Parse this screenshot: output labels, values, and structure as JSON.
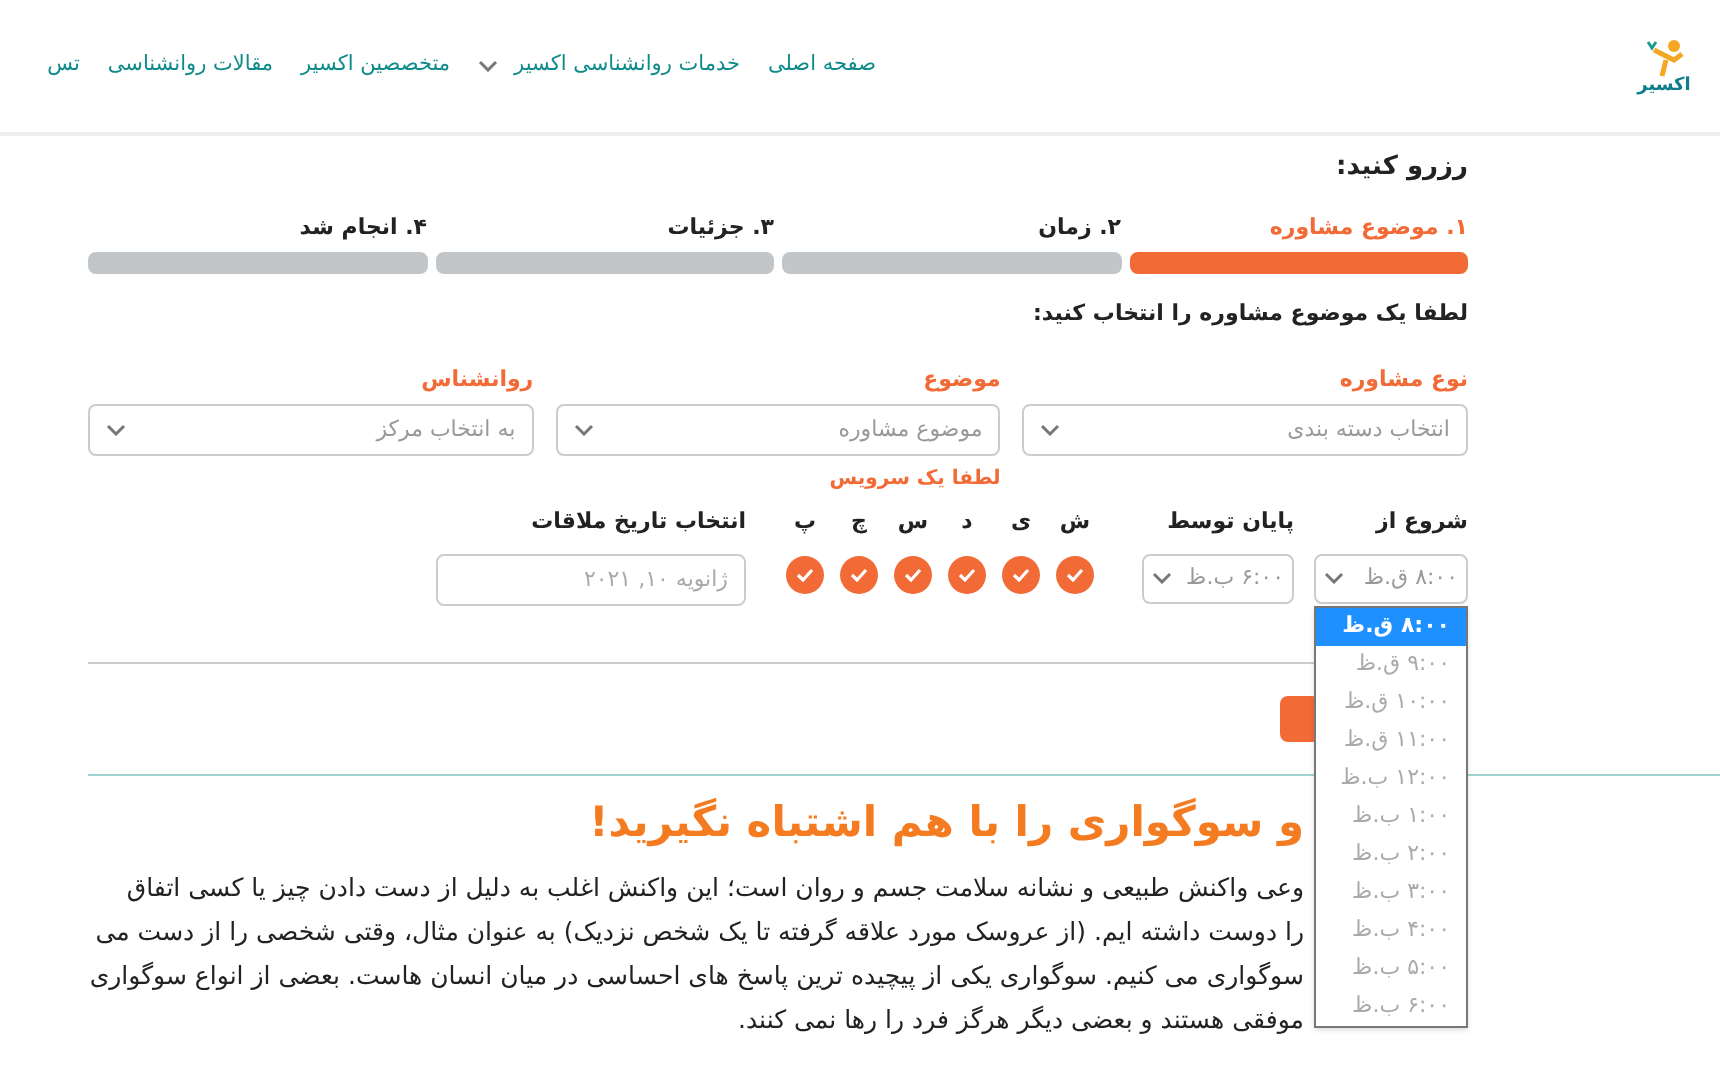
{
  "nav": {
    "logo_text": "اکسیر",
    "items": [
      {
        "label": "صفحه اصلی",
        "has_menu": false
      },
      {
        "label": "خدمات روانشناسی اکسیر",
        "has_menu": true
      },
      {
        "label": "متخصصین اکسیر",
        "has_menu": false
      },
      {
        "label": "مقالات روانشناسی",
        "has_menu": false
      },
      {
        "label": "تس",
        "has_menu": false
      }
    ]
  },
  "booking": {
    "title": "رزرو کنید:",
    "steps": [
      {
        "label": "۱. موضوع مشاوره",
        "selected": true
      },
      {
        "label": "۲. زمان",
        "selected": false
      },
      {
        "label": "۳. جزئیات",
        "selected": false
      },
      {
        "label": "۴. انجام شد",
        "selected": false
      }
    ],
    "instruction": "لطفا یک موضوع مشاوره را انتخاب کنید:",
    "selects": [
      {
        "label": "نوع مشاوره",
        "placeholder": "انتخاب دسته بندی"
      },
      {
        "label": "موضوع",
        "placeholder": "موضوع مشاوره",
        "error": "لطفا یک سرویس"
      },
      {
        "label": "روانشناس",
        "placeholder": "به انتخاب مرکز"
      }
    ],
    "start": {
      "label": "شروع از",
      "value": "۸:۰۰ ق.ظ",
      "expanded": true
    },
    "end": {
      "label": "پایان توسط",
      "value": "۶:۰۰ ب.ظ"
    },
    "days": [
      {
        "label": "ش",
        "checked": true
      },
      {
        "label": "ی",
        "checked": true
      },
      {
        "label": "د",
        "checked": true
      },
      {
        "label": "س",
        "checked": true
      },
      {
        "label": "چ",
        "checked": true
      },
      {
        "label": "پ",
        "checked": true
      }
    ],
    "date": {
      "label": "انتخاب تاریخ ملاقات",
      "placeholder": "ژانویه ۱۰, ۲۰۲۱"
    },
    "time_options": [
      {
        "label": "۸:۰۰ ق.ظ",
        "selected": true
      },
      {
        "label": "۹:۰۰ ق.ظ",
        "selected": false
      },
      {
        "label": "۱۰:۰۰ ق.ظ",
        "selected": false
      },
      {
        "label": "۱۱:۰۰ ق.ظ",
        "selected": false
      },
      {
        "label": "۱۲:۰۰ ب.ظ",
        "selected": false
      },
      {
        "label": "۱:۰۰ ب.ظ",
        "selected": false
      },
      {
        "label": "۲:۰۰ ب.ظ",
        "selected": false
      },
      {
        "label": "۳:۰۰ ب.ظ",
        "selected": false
      },
      {
        "label": "۴:۰۰ ب.ظ",
        "selected": false
      },
      {
        "label": "۵:۰۰ ب.ظ",
        "selected": false
      },
      {
        "label": "۶:۰۰ ب.ظ",
        "selected": false
      }
    ]
  },
  "article": {
    "heading": "و سوگواری را با هم اشتباه نگیرید!",
    "lines": [
      "وعی واکنش طبیعی و نشانه سلامت جسم و روان است؛ این واکنش اغلب به دلیل از دست دادن چیز یا کسی اتفاق",
      "را دوست داشته ایم. (از عروسک مورد علاقه گرفته تا یک شخص نزدیک) به عنوان مثال، وقتی شخصی را از دست می",
      "سوگواری می کنیم. سوگواری یکی از پیچیده ترین پاسخ های احساسی در میان انسان هاست. بعضی از انواع سوگواری",
      "موفقی هستند و بعضی دیگر هرگز فرد را رها نمی کنند."
    ]
  }
}
